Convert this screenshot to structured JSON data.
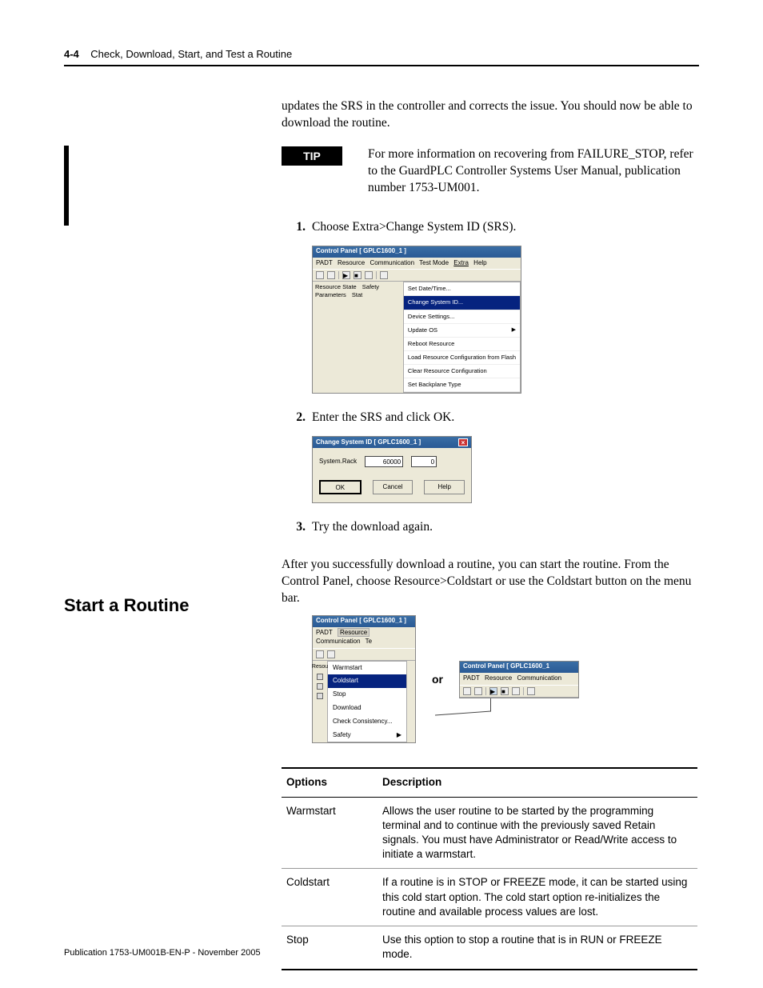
{
  "header": {
    "page_num": "4-4",
    "chapter_title": "Check, Download, Start, and Test a Routine"
  },
  "lead_para": "updates the SRS in the controller and corrects the issue. You should now be able to download the routine.",
  "tip": {
    "label": "TIP",
    "text": "For more information on recovering from FAILURE_STOP, refer to the GuardPLC Controller Systems User Manual, publication number 1753-UM001."
  },
  "steps": {
    "s1": {
      "num": "1.",
      "text": "Choose Extra>Change System ID (SRS)."
    },
    "s2": {
      "num": "2.",
      "text": "Enter the SRS and click OK."
    },
    "s3": {
      "num": "3.",
      "text": "Try the download again."
    }
  },
  "shot1": {
    "title": "Control Panel [ GPLC1600_1 ]",
    "menu": {
      "m1": "PADT",
      "m2": "Resource",
      "m3": "Communication",
      "m4": "Test Mode",
      "m5": "Extra",
      "m6": "Help"
    },
    "tabs": {
      "t1": "Resource State",
      "t2": "Safety Parameters",
      "t3": "Stat"
    },
    "drop": {
      "d1": "Set Date/Time...",
      "d2": "Change System ID...",
      "d3": "Device Settings...",
      "d4": "Update OS",
      "d5": "Reboot Resource",
      "d6": "Load Resource Configuration from Flash",
      "d7": "Clear Resource Configuration",
      "d8": "Set Backplane Type"
    }
  },
  "shot2": {
    "title": "Change System ID [ GPLC1600_1 ]",
    "label": "System.Rack",
    "val1": "60000",
    "val2": "0",
    "btn_ok": "OK",
    "btn_cancel": "Cancel",
    "btn_help": "Help"
  },
  "section": {
    "heading": "Start a Routine",
    "para": "After you successfully download a routine, you can start the routine. From the Control Panel, choose Resource>Coldstart or use the Coldstart button on the menu bar."
  },
  "shotA": {
    "title": "Control Panel [ GPLC1600_1 ]",
    "menu": {
      "m1": "PADT",
      "m2": "Resource",
      "m3": "Communication",
      "m4": "Te"
    },
    "left": "Resou",
    "items": {
      "i1": "Warmstart",
      "i2": "Coldstart",
      "i3": "Stop",
      "i4": "Download",
      "i5": "Check Consistency...",
      "i6": "Safety"
    }
  },
  "or_label": "or",
  "shotB": {
    "title": "Control Panel [ GPLC1600_1",
    "menu": {
      "m1": "PADT",
      "m2": "Resource",
      "m3": "Communication"
    }
  },
  "table": {
    "h1": "Options",
    "h2": "Description",
    "r1": {
      "opt": "Warmstart",
      "desc": "Allows the user routine to be started by the programming terminal and to continue with the previously saved Retain signals. You must have Administrator or Read/Write access to initiate a warmstart."
    },
    "r2": {
      "opt": "Coldstart",
      "desc": "If a routine is in STOP or FREEZE mode, it can be started using this cold start option. The cold start option re-initializes the routine and available process values are lost."
    },
    "r3": {
      "opt": "Stop",
      "desc": "Use this option to stop a routine that is in RUN or FREEZE mode."
    }
  },
  "footer": "Publication 1753-UM001B-EN-P - November 2005"
}
